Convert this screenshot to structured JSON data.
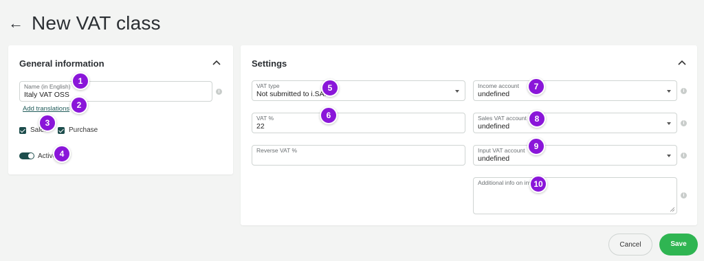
{
  "header": {
    "title": "New VAT class",
    "back_icon": "arrow-left-icon"
  },
  "general": {
    "title": "General information",
    "name_label": "Name (in English)",
    "name_value": "Italy VAT OSS",
    "add_translations": "Add translations",
    "sales_label": "Sales",
    "sales_checked": true,
    "purchase_label": "Purchase",
    "purchase_checked": true,
    "active_label": "Active",
    "active_on": true
  },
  "settings": {
    "title": "Settings",
    "vat_type_label": "VAT type",
    "vat_type_value": "Not submitted to i.SA.",
    "vat_percent_label": "VAT %",
    "vat_percent_value": "22",
    "reverse_vat_label": "Reverse VAT %",
    "reverse_vat_value": "",
    "income_account_label": "Income account",
    "income_account_value": "undefined",
    "sales_vat_label": "Sales VAT account",
    "sales_vat_value": "undefined",
    "input_vat_label": "Input VAT account",
    "input_vat_value": "undefined",
    "additional_info_label": "Additional info on invoice",
    "additional_info_value": ""
  },
  "badges": [
    "1",
    "2",
    "3",
    "4",
    "5",
    "6",
    "7",
    "8",
    "9",
    "10"
  ],
  "actions": {
    "cancel": "Cancel",
    "save": "Save"
  },
  "colors": {
    "accent_dark": "#1d4d4c",
    "save_green": "#2fb552",
    "badge_purple": "#8a16d9"
  }
}
